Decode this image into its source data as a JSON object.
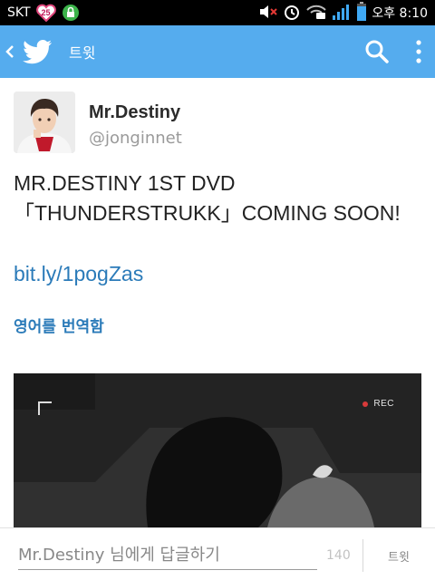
{
  "status_bar": {
    "carrier": "SKT",
    "notification_badge": "25",
    "time": "오후 8:10",
    "icons": [
      "heart-badge-icon",
      "lock-icon",
      "mute-icon",
      "alarm-icon",
      "wifi-icon",
      "signal-icon",
      "battery-icon"
    ]
  },
  "action_bar": {
    "title": "트윗",
    "icons": [
      "back-chevron-icon",
      "twitter-bird-icon",
      "search-icon",
      "overflow-menu-icon"
    ],
    "color": "#55acee"
  },
  "tweet": {
    "display_name": "Mr.Destiny",
    "handle": "@jonginnet",
    "text": "MR.DESTINY 1ST DVD「THUNDERSTRUKK」COMING SOON!",
    "link": "bit.ly/1pogZas",
    "translate_label": "영어를 번역함",
    "media": {
      "rec_label": "REC"
    }
  },
  "reply_bar": {
    "placeholder": "Mr.Destiny 님에게 답글하기",
    "char_count": "140",
    "tweet_button_label": "트윗"
  },
  "colors": {
    "accent": "#55acee",
    "link": "#2b7bb9"
  }
}
